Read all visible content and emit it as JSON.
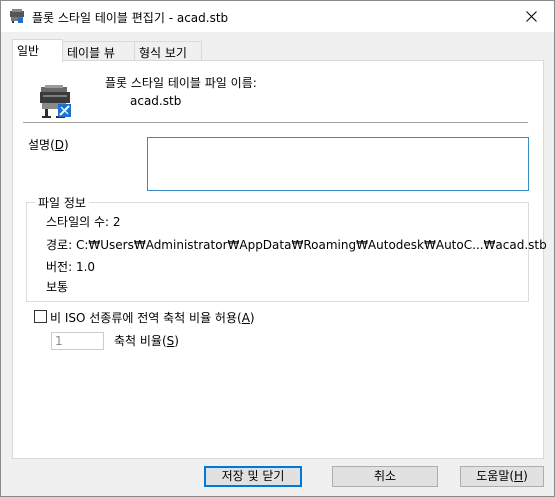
{
  "window": {
    "title": "플롯 스타일 테이블 편집기 - acad.stb"
  },
  "tabs": [
    {
      "label": "일반",
      "active": true
    },
    {
      "label": "테이블 뷰",
      "active": false
    },
    {
      "label": "형식 보기",
      "active": false
    }
  ],
  "general": {
    "file_label": "플롯 스타일 테이블 파일 이름:",
    "file_name": "acad.stb",
    "description_label": "설명(",
    "description_mnemonic": "D",
    "description_suffix": ")",
    "description_value": "",
    "file_info": {
      "title": "파일 정보",
      "style_count": "스타일의 수: 2",
      "path": "경로: C:₩Users₩Administrator₩AppData₩Roaming₩Autodesk₩AutoC...₩acad.stb",
      "version": "버전: 1.0",
      "extra": "보통"
    },
    "iso_checkbox": {
      "label_prefix": "비 ISO 선종류에 전역 축척 비율 허용(",
      "mnemonic": "A",
      "label_suffix": ")",
      "checked": false
    },
    "scale": {
      "value": "1",
      "label_prefix": "축척 비율(",
      "mnemonic": "S",
      "label_suffix": ")"
    }
  },
  "buttons": {
    "save_close": "저장 및 닫기",
    "cancel": "취소",
    "help_prefix": "도움말(",
    "help_mnemonic": "H",
    "help_suffix": ")"
  },
  "colors": {
    "accent": "#0078d7",
    "input_border_focus": "#3c8cc3"
  }
}
